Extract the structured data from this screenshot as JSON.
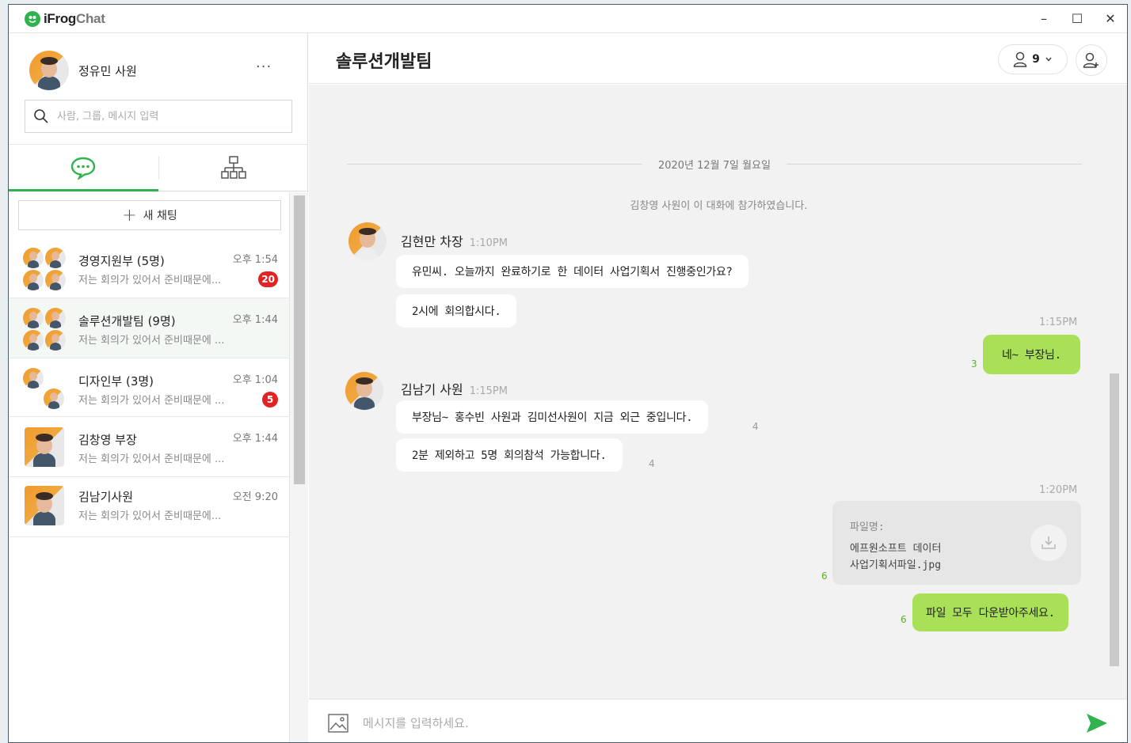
{
  "app": {
    "logo_brand": "iFrog",
    "logo_suffix": "Chat",
    "window_controls": {
      "minimize": "–",
      "maximize": "☐",
      "close": "✕"
    }
  },
  "profile": {
    "name": "정유민 사원",
    "more": "···"
  },
  "search": {
    "placeholder": "사람, 그룹, 메시지 입력"
  },
  "tabs": [
    {
      "icon": "chat-bubble-icon",
      "active": true
    },
    {
      "icon": "org-chart-icon",
      "active": false
    }
  ],
  "new_chat_label": "새 채팅",
  "chats": [
    {
      "title": "경영지원부 (5명)",
      "preview": "저는 회의가 있어서 준비때문에...",
      "time": "오후 1:54",
      "unread": "20",
      "group": true
    },
    {
      "title": "솔루션개발팀 (9명)",
      "preview": "저는 회의가 있어서 준비때문에 ...",
      "time": "오후 1:44",
      "unread": "",
      "group": true,
      "selected": true
    },
    {
      "title": "디자인부 (3명)",
      "preview": "저는 회의가 있어서 준비때문에 ...",
      "time": "오후 1:04",
      "unread": "5",
      "group": true
    },
    {
      "title": "김창영 부장",
      "preview": "저는 회의가 있어서 준비때문에 ...",
      "time": "오후 1:44",
      "unread": "",
      "group": false
    },
    {
      "title": "김남기사원",
      "preview": "저는 회의가 있어서 준비때문에...",
      "time": "오전 9:20",
      "unread": "",
      "group": false
    }
  ],
  "room": {
    "title": "솔루션개발팀",
    "member_count": "9",
    "date_divider": "2020년 12월 7일 월요일",
    "system_message": "김창영 사원이 이 대화에 참가하였습니다."
  },
  "messages": {
    "sender1": {
      "name": "김현만 차장",
      "time": "1:10PM"
    },
    "m1": "유민씨. 오늘까지 완료하기로 한 데이터 사업기획서 진행중인가요?",
    "m2": "2시에 회의합시다.",
    "mine_time1": "1:15PM",
    "mine1": "네~ 부장님.",
    "mine1_read": "3",
    "sender2": {
      "name": "김남기 사원",
      "time": "1:15PM"
    },
    "m3": "부장님~ 홍수빈 사원과 김미선사원이 지금 외근 중입니다.",
    "m3_read": "4",
    "m4": "2분 제외하고 5명 회의참석 가능합니다.",
    "m4_read": "4",
    "mine_time2": "1:20PM",
    "file_label": "파일명:",
    "file_name_line1": "에프원소프트 데이터",
    "file_name_line2": "사업기획서파일.jpg",
    "file_read": "6",
    "mine2": "파일 모두 다운받아주세요.",
    "mine2_read": "6"
  },
  "composer": {
    "placeholder": "메시지를 입력하세요."
  },
  "colors": {
    "accent_green": "#2fb34e",
    "my_bubble": "#a9e057",
    "badge_red": "#e02424"
  }
}
